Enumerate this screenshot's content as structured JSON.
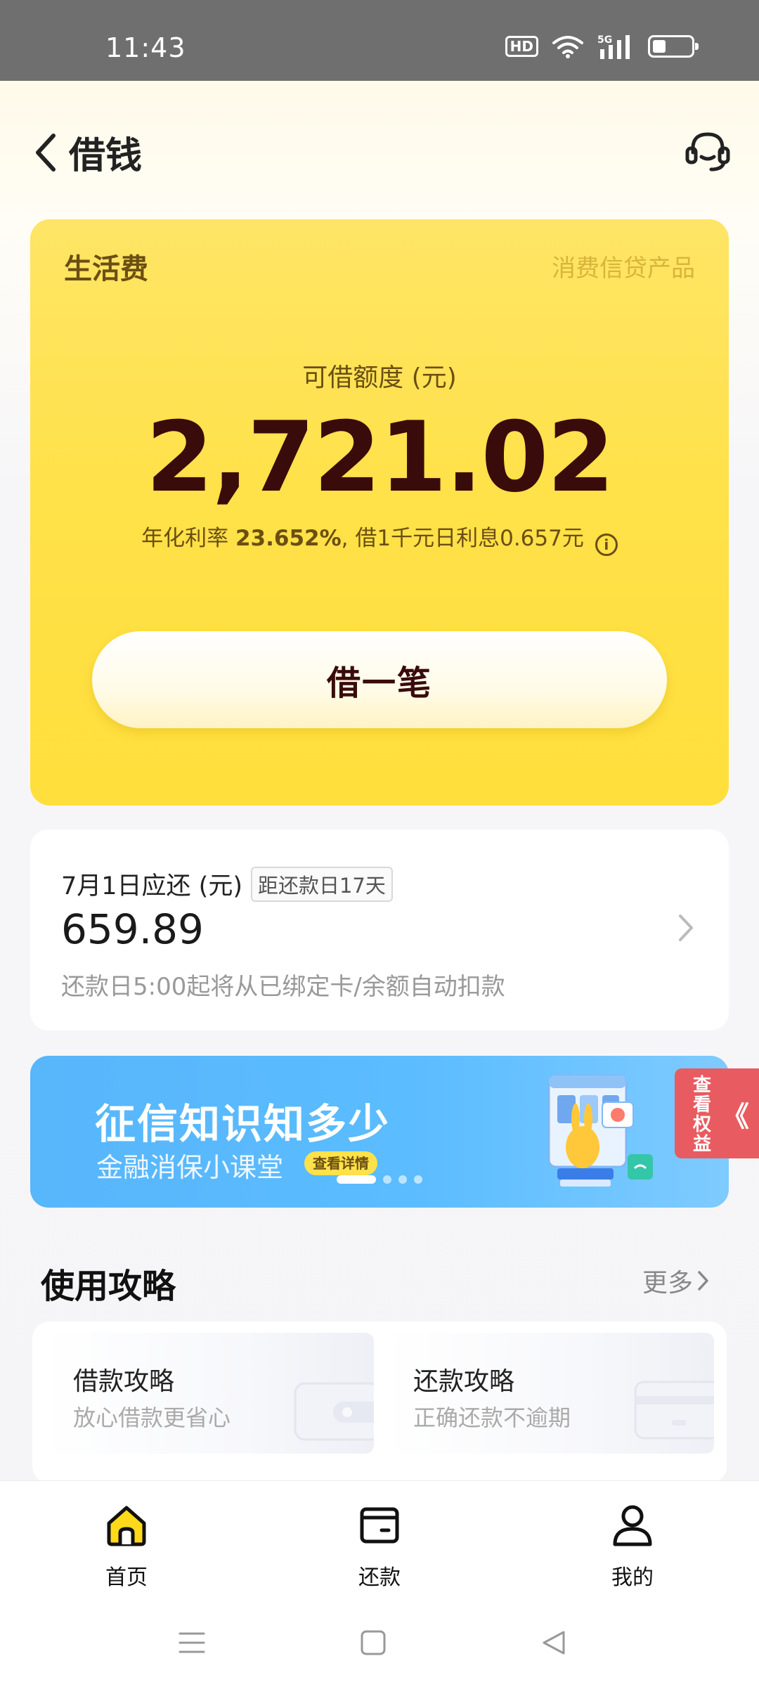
{
  "status_bar": {
    "time": "11:43",
    "hd_label": "HD",
    "network": "5G"
  },
  "header": {
    "title": "借钱"
  },
  "loan_card": {
    "product_name": "生活费",
    "product_type": "消费信贷产品",
    "amount_label": "可借额度 (元)",
    "amount": "2,721.02",
    "rate_prefix": "年化利率 ",
    "rate_value": "23.652%",
    "rate_suffix": ", 借1千元日利息0.657元",
    "borrow_button": "借一笔"
  },
  "repay_card": {
    "title": "7月1日应还 (元)",
    "countdown": "距还款日17天",
    "amount": "659.89",
    "note": "还款日5:00起将从已绑定卡/余额自动扣款"
  },
  "banner": {
    "title": "征信知识知多少",
    "subtitle": "金融消保小课堂",
    "pill": "查看详情",
    "active_index": 0,
    "slide_count": 4
  },
  "side_tab": {
    "label": "查看权益",
    "arrow": "《"
  },
  "guide_section": {
    "title": "使用攻略",
    "more": "更多",
    "items": [
      {
        "title": "借款攻略",
        "subtitle": "放心借款更省心"
      },
      {
        "title": "还款攻略",
        "subtitle": "正确还款不逾期"
      }
    ]
  },
  "bottom_nav": {
    "items": [
      {
        "label": "首页",
        "icon": "home-icon",
        "active": true
      },
      {
        "label": "还款",
        "icon": "wallet-icon",
        "active": false
      },
      {
        "label": "我的",
        "icon": "user-icon",
        "active": false
      }
    ]
  },
  "colors": {
    "accent_yellow": "#ffe14a",
    "dark_brown": "#3a0b0b",
    "banner_blue": "#5bbcff"
  }
}
